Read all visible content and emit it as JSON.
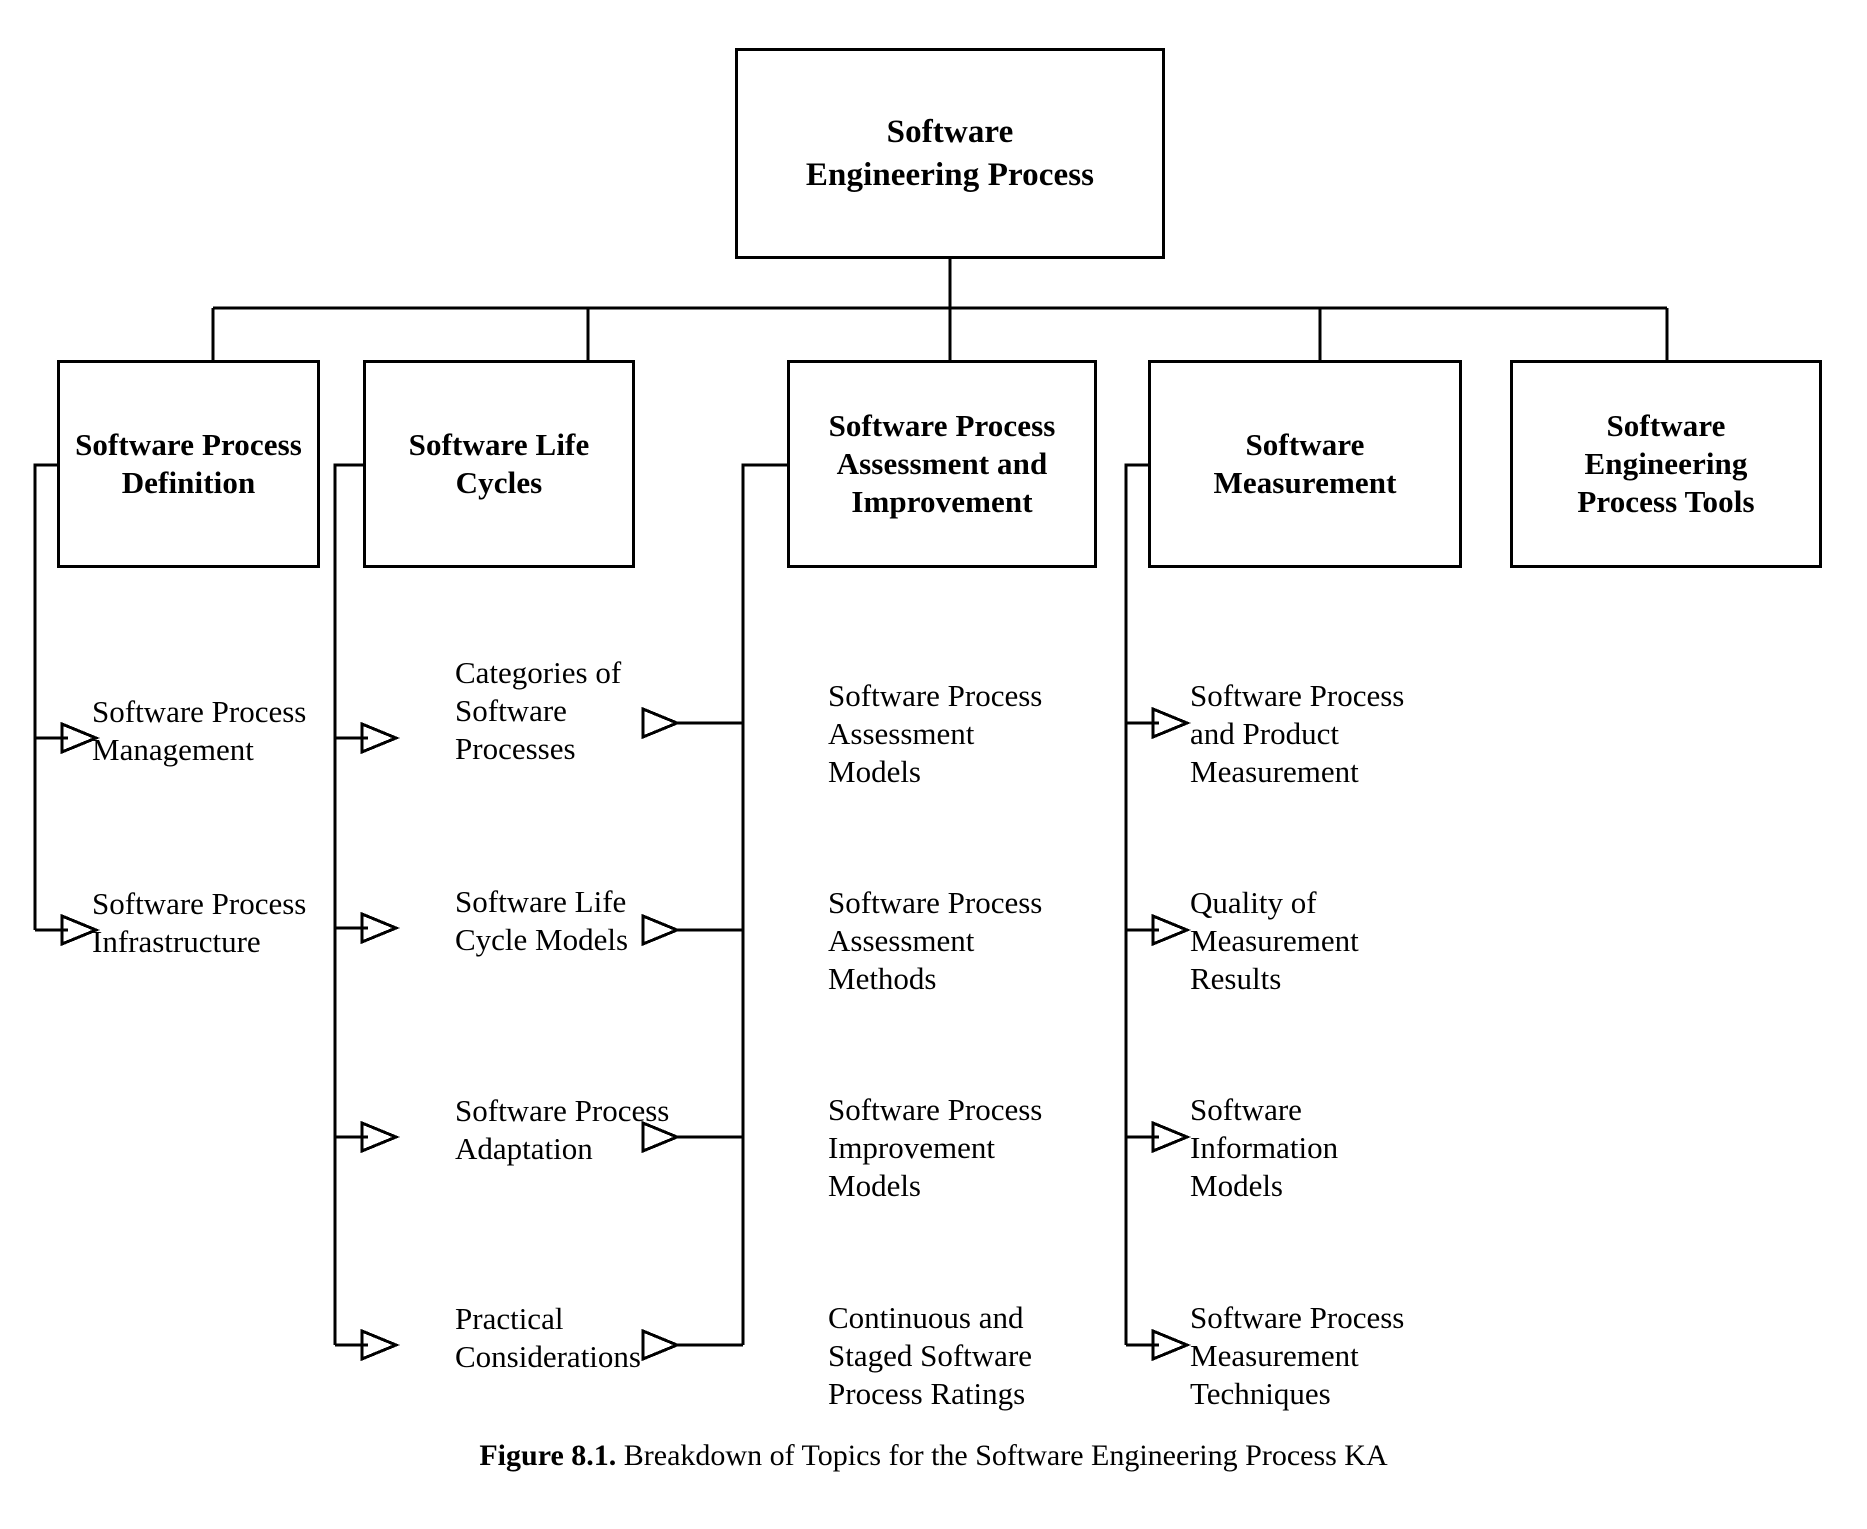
{
  "figure": {
    "caption_prefix": "Figure 8.1.",
    "caption_text": " Breakdown of Topics for the Software Engineering Process KA",
    "line_color": "#000000",
    "background": "#ffffff"
  },
  "root": {
    "label": "Software\nEngineering Process"
  },
  "branches": [
    {
      "title": "Software Process\nDefinition",
      "items": [
        "Software Process\nManagement",
        "Software Process\nInfrastructure"
      ]
    },
    {
      "title": "Software Life\nCycles",
      "items": [
        "Categories of\nSoftware\nProcesses",
        "Software Life\nCycle Models",
        "Software Process\nAdaptation",
        "Practical\nConsiderations"
      ]
    },
    {
      "title": "Software Process\nAssessment and\nImprovement",
      "items": [
        "Software Process\nAssessment\nModels",
        "Software Process\nAssessment\nMethods",
        "Software Process\nImprovement\nModels",
        "Continuous and\nStaged Software\nProcess Ratings"
      ]
    },
    {
      "title": "Software\nMeasurement",
      "items": [
        "Software Process\nand Product\nMeasurement",
        "Quality of\nMeasurement\nResults",
        "Software\nInformation\nModels",
        "Software Process\nMeasurement\nTechniques"
      ]
    },
    {
      "title": "Software\nEngineering\nProcess Tools",
      "items": []
    }
  ]
}
